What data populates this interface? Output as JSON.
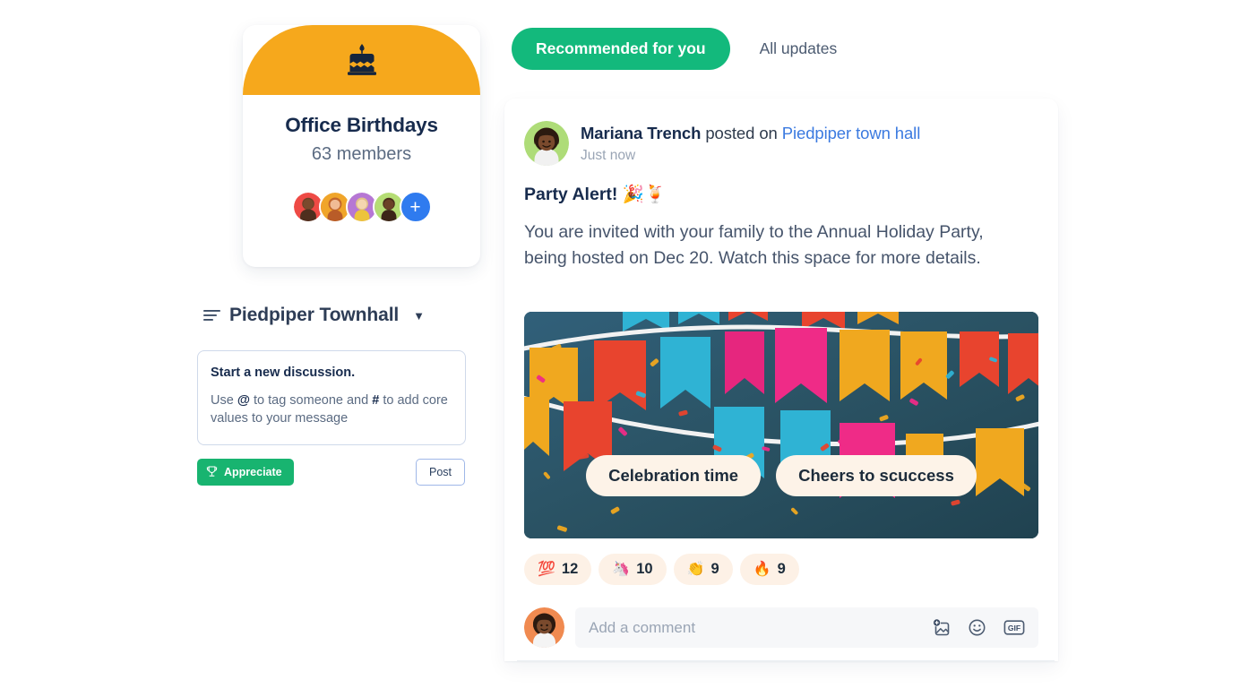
{
  "group_card": {
    "cover_icon": "birthday-cake-icon",
    "cover_color": "#F6A81C",
    "name": "Office Birthdays",
    "members": "63 members",
    "add_member_label": "+",
    "avatar_ring_colors": [
      "#EE4A45",
      "#F0A52A",
      "#B677D4",
      "#B5DD74"
    ]
  },
  "composer": {
    "channel": "Piedpiper Townhall",
    "channel_icon": "list-icon",
    "caret_icon": "chevron-down-icon",
    "title": "Start a new discussion.",
    "hint_prefix": "Use ",
    "hint_at": "@",
    "hint_mid": " to tag someone and ",
    "hint_hash": "#",
    "hint_suffix": " to add core values to your message",
    "appreciate_label": "Appreciate",
    "appreciate_icon": "trophy-icon",
    "appreciate_color": "#18b470",
    "post_label": "Post"
  },
  "tabs": [
    {
      "label": "Recommended for you",
      "active": true
    },
    {
      "label": "All updates",
      "active": false
    }
  ],
  "tab_active_color": "#13b97c",
  "post": {
    "author": "Mariana Trench",
    "action": " posted on ",
    "channel": "Piedpiper town hall",
    "channel_color": "#3b7ae0",
    "time": "Just now",
    "title": "Party Alert! 🎉🍹",
    "body": "You are invited with your family to the Annual Holiday Party, being hosted on Dec 20. Watch this space for more details.",
    "banner": {
      "background_color": "#2b5465",
      "pills": [
        "Celebration time",
        "Cheers to scuccess"
      ],
      "pill_color": "#fdf3e8"
    },
    "reactions": [
      {
        "emoji": "💯",
        "count": "12"
      },
      {
        "emoji": "🦄",
        "count": "10"
      },
      {
        "emoji": "👏",
        "count": "9"
      },
      {
        "emoji": "🔥",
        "count": "9"
      }
    ],
    "comment": {
      "placeholder": "Add a comment",
      "icons": [
        "add-photo-icon",
        "emoji-smiley-icon",
        "gif-icon"
      ]
    }
  }
}
